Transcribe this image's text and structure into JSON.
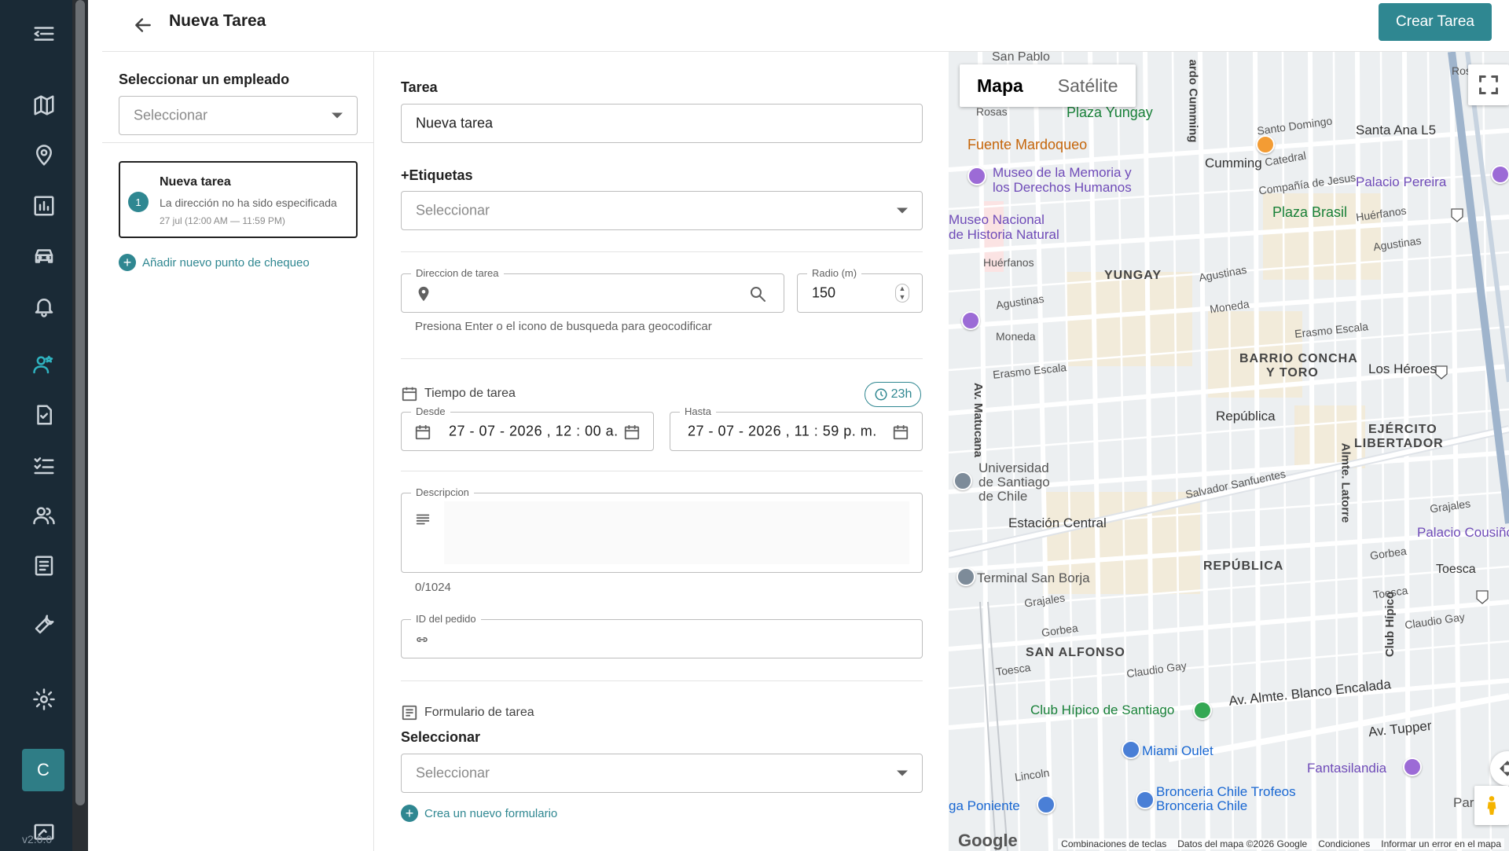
{
  "header": {
    "title": "Nueva Tarea",
    "create_label": "Crear Tarea"
  },
  "sidebar": {
    "items": [
      "menu-collapse",
      "map",
      "location-pin",
      "reports",
      "vehicles",
      "notifications",
      "employee-tasks",
      "task-check",
      "checklist",
      "users",
      "forms",
      "tools",
      "settings"
    ],
    "active": "employee-tasks",
    "avatar_letter": "C",
    "version": "v2.0.0"
  },
  "left_panel": {
    "employee_label": "Seleccionar un empleado",
    "employee_placeholder": "Seleccionar",
    "checkpoint": {
      "number": "1",
      "title": "Nueva tarea",
      "subtitle": "La dirección no ha sido especificada",
      "time": "27 jul (12:00 AM — 11:59 PM)"
    },
    "add_checkpoint_label": "Añadir nuevo punto de chequeo"
  },
  "form": {
    "task_label": "Tarea",
    "task_value": "Nueva tarea",
    "tags_label": "+Etiquetas",
    "tags_placeholder": "Seleccionar",
    "address_legend": "Direccion de tarea",
    "radius_legend": "Radio (m)",
    "radius_value": "150",
    "address_hint": "Presiona Enter o el icono de busqueda para geocodificar",
    "time_section": "Tiempo de tarea",
    "duration_chip": "23h",
    "from_legend": "Desde",
    "from_value": "27 - 07 - 2026 ,  12 : 00   a.",
    "to_legend": "Hasta",
    "to_value": "27 - 07 - 2026 ,  11 : 59   p. m.",
    "description_legend": "Descripcion",
    "description_counter": "0/1024",
    "order_legend": "ID del pedido",
    "form_section": "Formulario de tarea",
    "form_select_label": "Seleccionar",
    "form_placeholder": "Seleccionar",
    "new_form_label": "Crea un nuevo formulario"
  },
  "map": {
    "tab_map": "Mapa",
    "tab_satellite": "Satélite",
    "labels": {
      "san_pablo": "San Pablo",
      "rosas": "Rosas",
      "rosas2": "Rosas",
      "plaza_yungay": "Plaza Yungay",
      "cumming": "Cumming",
      "catedral": "Catedral",
      "santo_domingo": "Santo Domingo",
      "santa_ana": "Santa Ana L5",
      "fuente_mardoqueo": "Fuente Mardoqueo",
      "museo_memoria": "Museo de la Memoria y",
      "museo_memoria2": "los Derechos Humanos",
      "palacio_pereira": "Palacio Pereira",
      "compania": "Compañía de Jesus",
      "plaza_brasil": "Plaza Brasil",
      "huerfanos": "Huérfanos",
      "museo_nacional": "Museo Nacional",
      "museo_nacional2": "de Historia Natural",
      "yungay": "YUNGAY",
      "agustinas": "Agustinas",
      "moneda": "Moneda",
      "moneda2": "Moneda",
      "barrio_concha": "BARRIO CONCHA",
      "y_toro": "Y TORO",
      "los_heroes": "Los Héroes",
      "erasmo_escala": "Erasmo Escala",
      "republica": "República",
      "ejercito": "EJÉRCITO",
      "libertador": "LIBERTADOR",
      "universidad": "Universidad",
      "universidad2": "de Santiago",
      "universidad3": "de Chile",
      "estacion_central": "Estación Central",
      "salvador": "Salvador Sanfuentes",
      "palacio_cousino": "Palacio Cousiño",
      "terminal": "Terminal San Borja",
      "republica_big": "REPÚBLICA",
      "toesca": "Toesca",
      "gorbea": "Gorbea",
      "grajales": "Grajales",
      "san_alfonso": "SAN ALFONSO",
      "claudio_gay": "Claudio Gay",
      "club_hipico": "Club Hípico de Santiago",
      "blanco_encalada": "Av. Almte. Blanco Encalada",
      "av_tupper": "Av. Tupper",
      "miami": "Miami Oulet",
      "fantasilandia": "Fantasilandia",
      "lincoln": "Lincoln",
      "bronceria": "Bronceria Chile Trofeos",
      "bronceria2": "Bronceria Chile",
      "parque": "Parqu",
      "poniente": "ga Poniente",
      "matucana": "Av. Matucana",
      "latorre": "Almte. Latorre",
      "club_hipico_st": "Club Hípico",
      "cumming_v": "ardo Cumming"
    },
    "footer": {
      "logo": "Google",
      "shortcuts": "Combinaciones de teclas",
      "data": "Datos del mapa ©2026 Google",
      "terms": "Condiciones",
      "report": "Informar un error en el mapa"
    }
  }
}
